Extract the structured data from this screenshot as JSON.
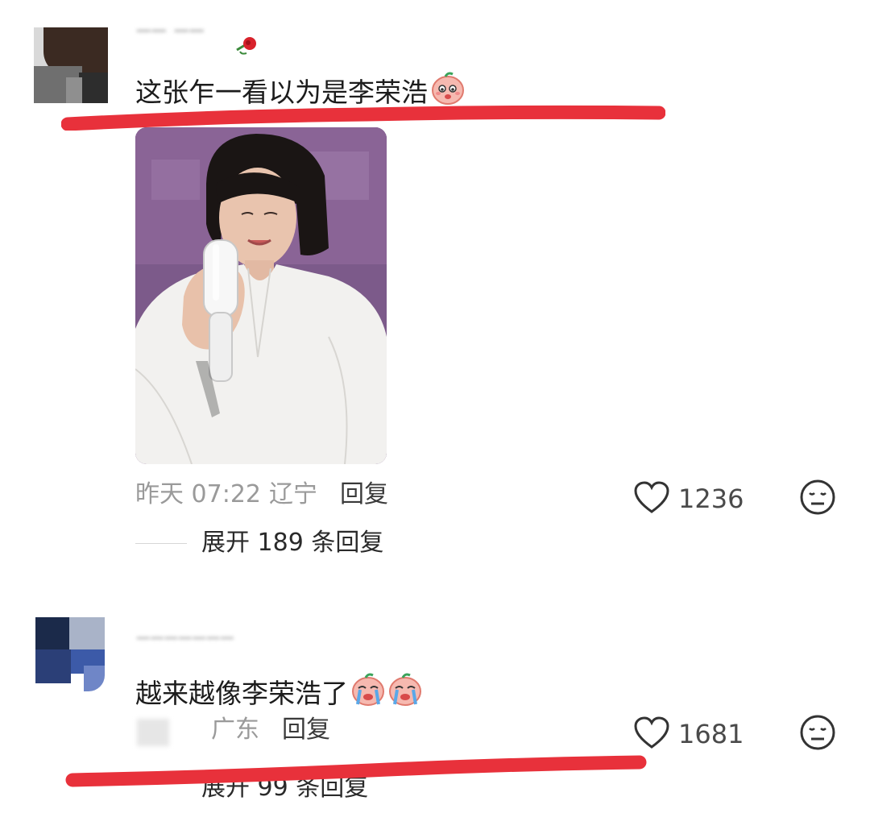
{
  "comments": [
    {
      "text": "这张乍一看以为是李荣浩",
      "emoji": "peach-shy-emoji",
      "time": "昨天 07:22",
      "location": "辽宁",
      "reply_label": "回复",
      "likes": "1236",
      "expand": "展开 189 条回复",
      "has_photo": true
    },
    {
      "text": "越来越像李荣浩了",
      "emoji": "peach-crying-emoji",
      "location": "广东",
      "reply_label": "回复",
      "likes": "1681",
      "expand": "展开 99 条回复"
    }
  ],
  "colors": {
    "annotation_underline": "#e8313b",
    "meta_gray": "#9a9a9a",
    "photo_backdrop": "#7a5a86"
  }
}
